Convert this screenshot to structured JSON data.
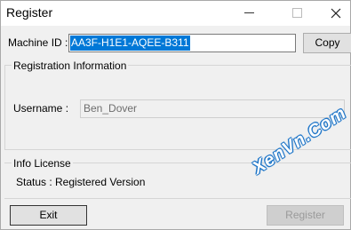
{
  "window": {
    "title": "Register"
  },
  "machine": {
    "label": "Machine ID :",
    "value": "AA3F-H1E1-AQEE-B311",
    "copy_label": "Copy"
  },
  "registration": {
    "group_title": "Registration Information",
    "username_label": "Username  :",
    "username_value": "Ben_Dover"
  },
  "info": {
    "group_title": "Info License",
    "status_label": "Status :",
    "status_value": "Registered Version"
  },
  "actions": {
    "exit_label": "Exit",
    "register_label": "Register"
  },
  "watermark": {
    "text": "XenVn.Com"
  },
  "colors": {
    "selection": "#0078d7",
    "window_bg": "#f0f0f0",
    "watermark": "#1570c6"
  },
  "icons": [
    "minimize-icon",
    "maximize-icon",
    "close-icon"
  ]
}
